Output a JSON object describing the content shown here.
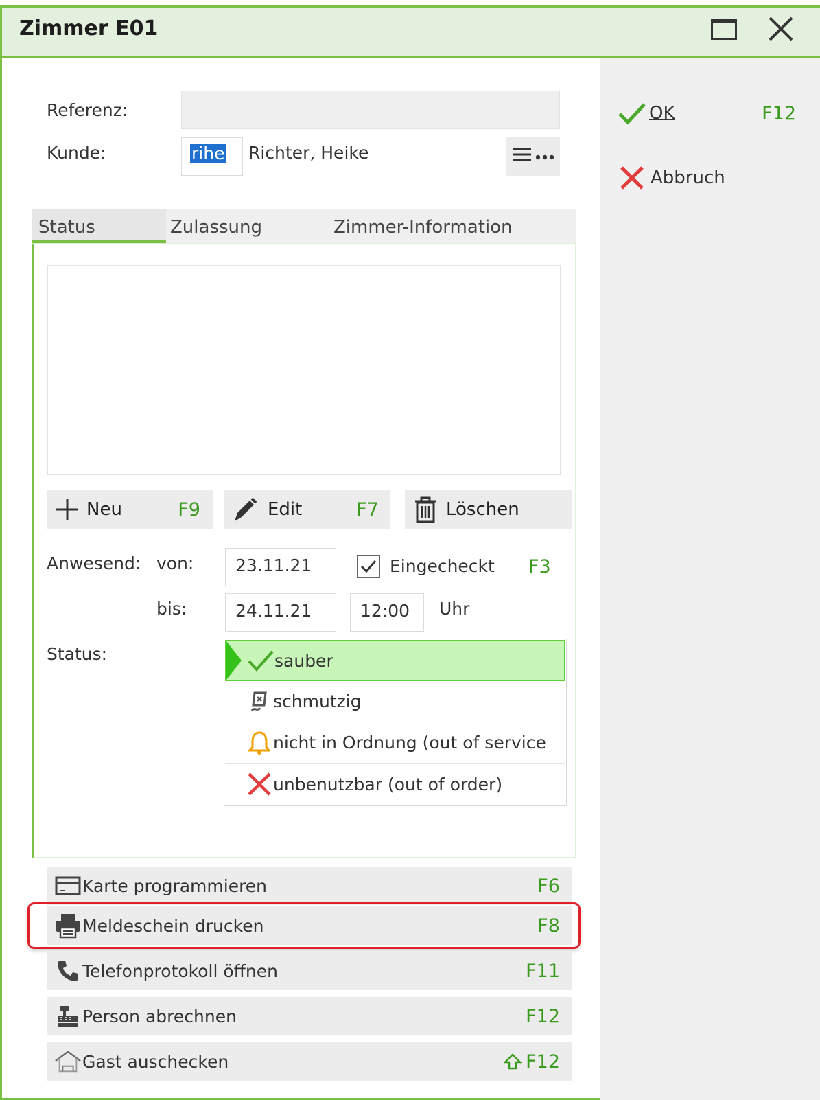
{
  "window": {
    "title": "Zimmer E01"
  },
  "form": {
    "referenz_label": "Referenz:",
    "referenz_value": "",
    "kunde_label": "Kunde:",
    "kunde_code": "rihe",
    "kunde_name": "Richter, Heike"
  },
  "tabs": [
    {
      "label": "Status",
      "active": true
    },
    {
      "label": "Zulassung",
      "active": false
    },
    {
      "label": "Zimmer-Information",
      "active": false
    }
  ],
  "list_buttons": {
    "neu": {
      "label": "Neu",
      "key": "F9"
    },
    "edit": {
      "label": "Edit",
      "key": "F7"
    },
    "loeschen": {
      "label": "Löschen"
    }
  },
  "presence": {
    "label": "Anwesend:",
    "von_label": "von:",
    "von_value": "23.11.21",
    "checked_in_label": "Eingecheckt",
    "checked_in_key": "F3",
    "checked_in": true,
    "bis_label": "bis:",
    "bis_value": "24.11.21",
    "time_value": "12:00",
    "time_unit": "Uhr"
  },
  "status": {
    "label": "Status:",
    "options": [
      {
        "label": "sauber",
        "icon": "check-icon",
        "selected": true
      },
      {
        "label": "schmutzig",
        "icon": "dirty-icon",
        "selected": false
      },
      {
        "label": "nicht in Ordnung (out of service",
        "icon": "bell-icon",
        "selected": false
      },
      {
        "label": "unbenutzbar (out of order)",
        "icon": "x-icon",
        "selected": false
      }
    ]
  },
  "actions": [
    {
      "label": "Karte programmieren",
      "key": "F6",
      "icon": "card-icon"
    },
    {
      "label": "Meldeschein drucken",
      "key": "F8",
      "icon": "printer-icon",
      "highlighted": true
    },
    {
      "label": "Telefonprotokoll öffnen",
      "key": "F11",
      "icon": "phone-icon"
    },
    {
      "label": "Person abrechnen",
      "key": "F12",
      "icon": "cash-register-icon"
    },
    {
      "label": "Gast auschecken",
      "key": "F12",
      "icon": "house-icon",
      "shift": true
    }
  ],
  "side": {
    "ok_label": "OK",
    "ok_key": "F12",
    "cancel_label": "Abbruch"
  },
  "colors": {
    "accent": "#7ac143",
    "fkey": "#3a9a1e",
    "cancel": "#e23c3c",
    "highlight_border": "#e0202a"
  }
}
